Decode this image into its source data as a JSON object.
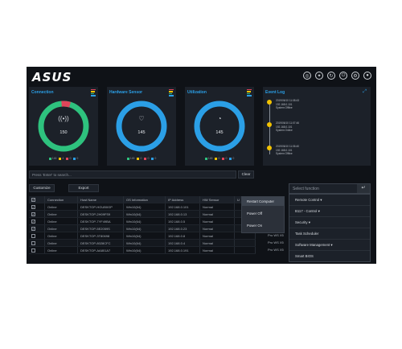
{
  "app": {
    "logo": "ASUS"
  },
  "topbar": {
    "icons": [
      "globe-icon",
      "gear-icon",
      "refresh-icon",
      "power-icon",
      "settings-icon",
      "user-icon"
    ]
  },
  "cards": [
    {
      "title": "Connection",
      "value": "150",
      "icon": "broadcast-icon",
      "ring_color": "#2ec27e",
      "ring_segments": [
        {
          "color": "#2ec27e",
          "fraction": 0.94
        },
        {
          "color": "#e0455a",
          "fraction": 0.06
        }
      ],
      "legend": [
        "146",
        "4",
        "0",
        "0"
      ]
    },
    {
      "title": "Hardware Sensor",
      "value": "145",
      "icon": "heart-pulse-icon",
      "ring_color": "#2b9fe6",
      "ring_segments": [
        {
          "color": "#2b9fe6",
          "fraction": 1.0
        }
      ],
      "legend": [
        "145",
        "0",
        "0",
        "0"
      ]
    },
    {
      "title": "Utilization",
      "value": "145",
      "icon": "gauge-icon",
      "ring_color": "#2b9fe6",
      "ring_segments": [
        {
          "color": "#2b9fe6",
          "fraction": 1.0
        }
      ],
      "legend": [
        "145",
        "0",
        "0",
        "0"
      ]
    }
  ],
  "legend_colors": [
    "#2ec27e",
    "#f2c200",
    "#e0455a",
    "#2b9fe6"
  ],
  "event_log": {
    "title": "Event Log",
    "items": [
      {
        "time": "2019/06/10 11:08:43",
        "host": "192.168.0.101",
        "msg": "System Offline"
      },
      {
        "time": "2019/06/10 11:07:46",
        "host": "192.168.0.101",
        "msg": "System Online"
      },
      {
        "time": "2019/06/10 11:06:40",
        "host": "192.168.0.101",
        "msg": "System Offline"
      }
    ]
  },
  "search": {
    "placeholder": "Press 'Enter' to search...",
    "clear": "Clear"
  },
  "toolbar": {
    "customize": "Customize",
    "export": "Export"
  },
  "table": {
    "headers": [
      "",
      "Connection",
      "Host Name",
      "OS Information",
      "IP Address",
      "HW Sensor",
      "U"
    ],
    "rows": [
      {
        "checked": true,
        "connection": "Online",
        "host": "DESKTOP-HGUB0GP",
        "os": "Win10(64)",
        "ip": "192.168.0.101",
        "hw": "Normal"
      },
      {
        "checked": true,
        "connection": "Online",
        "host": "DESKTOP-2H09FS9",
        "os": "Win10(64)",
        "ip": "192.168.0.13",
        "hw": "Normal"
      },
      {
        "checked": true,
        "connection": "Online",
        "host": "DESKTOP-7YF49BA",
        "os": "Win10(64)",
        "ip": "192.168.0.5",
        "hw": "Normal"
      },
      {
        "checked": true,
        "connection": "Online",
        "host": "DESKTOP-5E2059S",
        "os": "Win10(64)",
        "ip": "192.168.0.23",
        "hw": "Normal"
      },
      {
        "checked": false,
        "connection": "Online",
        "host": "DESKTOP-3T80698",
        "os": "Win10(64)",
        "ip": "192.168.0.8",
        "hw": "Normal"
      },
      {
        "checked": false,
        "connection": "Online",
        "host": "DESKTOP-8028CFC",
        "os": "Win10(64)",
        "ip": "192.168.0.4",
        "hw": "Normal"
      },
      {
        "checked": false,
        "connection": "Online",
        "host": "DESKTOP-AA801A7",
        "os": "Win10(64)",
        "ip": "192.168.0.191",
        "hw": "Normal"
      }
    ],
    "overflow": [
      "Pro WS X5",
      "Pro WS X5",
      "Pro WS X5"
    ]
  },
  "context_menu": {
    "items": [
      "Restart Computer",
      "Power Off",
      "Power On"
    ]
  },
  "function_select": {
    "placeholder": "Select function",
    "items": [
      "Remote Control ▾",
      "B117 - Control ▾",
      "Security ▾",
      "Task Scheduler",
      "Software Management ▾",
      "Smart BIOS"
    ]
  }
}
